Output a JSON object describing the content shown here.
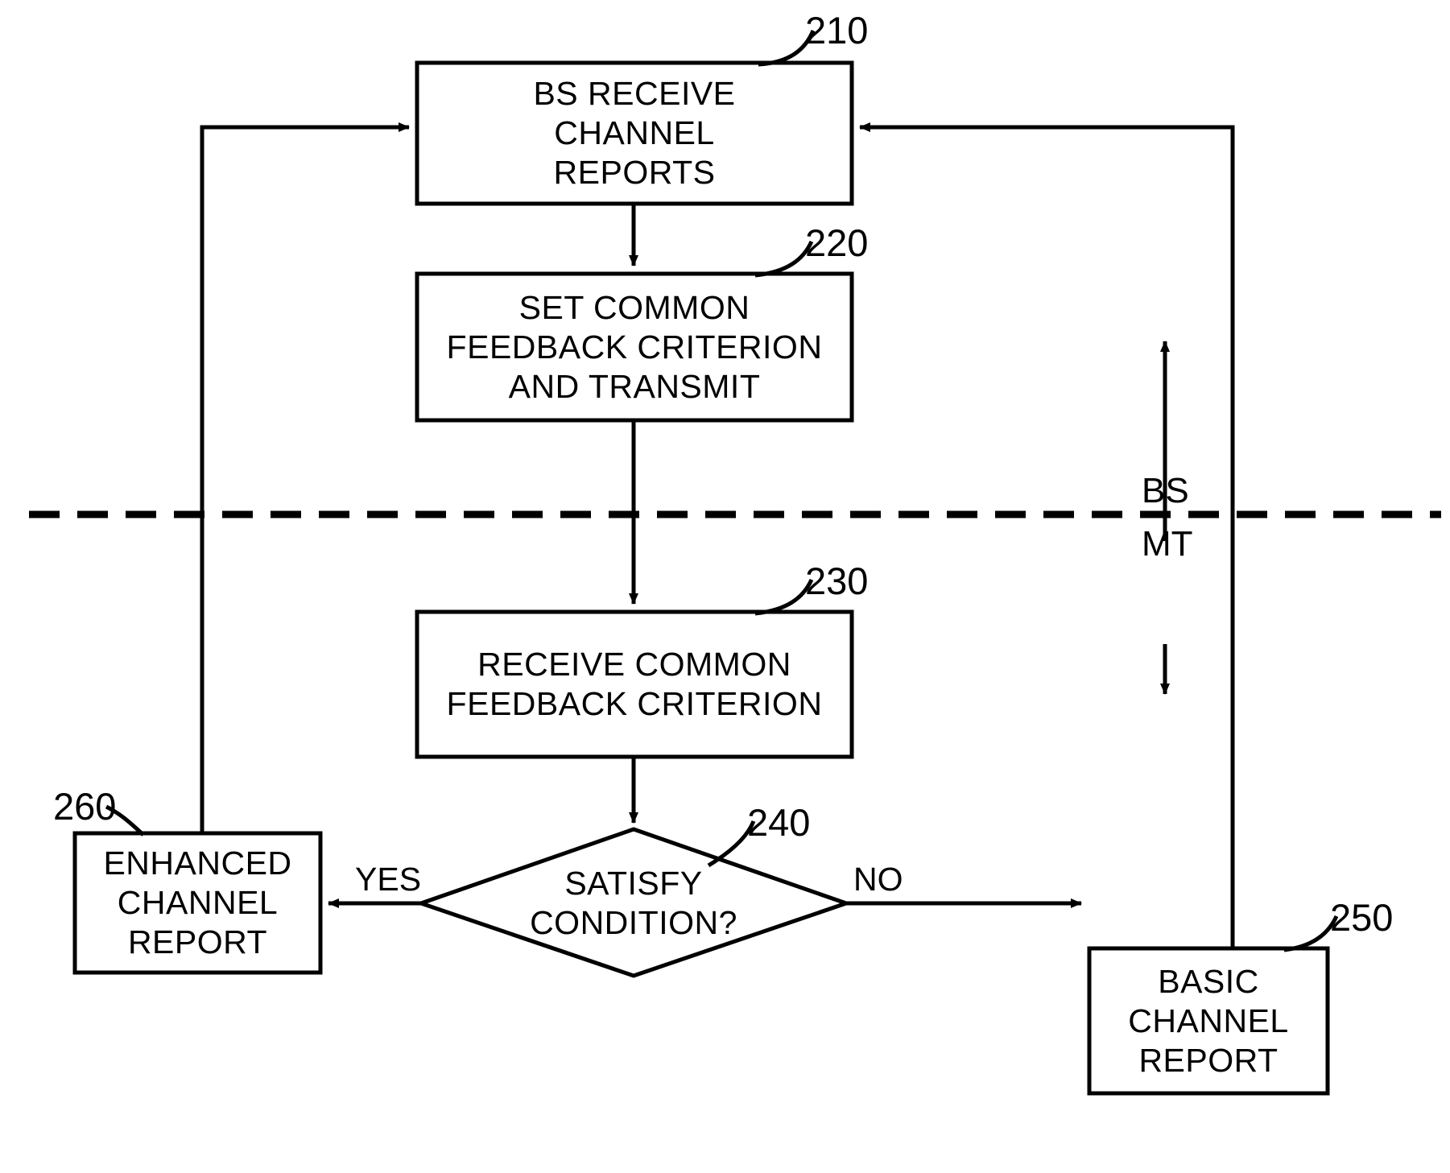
{
  "figure": {
    "type": "flowchart",
    "background_color": "#ffffff",
    "line_color": "#000000"
  },
  "nodes": [
    {
      "id": "210",
      "shape": "rectangle",
      "label": "BS RECEIVE\nCHANNEL\nREPORTS",
      "ref": "210"
    },
    {
      "id": "220",
      "shape": "rectangle",
      "label": "SET COMMON\nFEEDBACK CRITERION\nAND TRANSMIT",
      "ref": "220"
    },
    {
      "id": "230",
      "shape": "rectangle",
      "label": "RECEIVE COMMON\nFEEDBACK CRITERION",
      "ref": "230"
    },
    {
      "id": "240",
      "shape": "diamond",
      "label": "SATISFY\nCONDITION?",
      "ref": "240"
    },
    {
      "id": "250",
      "shape": "rectangle",
      "label": "BASIC\nCHANNEL\nREPORT",
      "ref": "250"
    },
    {
      "id": "260",
      "shape": "rectangle",
      "label": "ENHANCED\nCHANNEL\nREPORT",
      "ref": "260"
    }
  ],
  "edge_labels": {
    "yes": "YES",
    "no": "NO"
  },
  "divider": {
    "style": "dashed",
    "upper_label": "BS",
    "lower_label": "MT"
  }
}
